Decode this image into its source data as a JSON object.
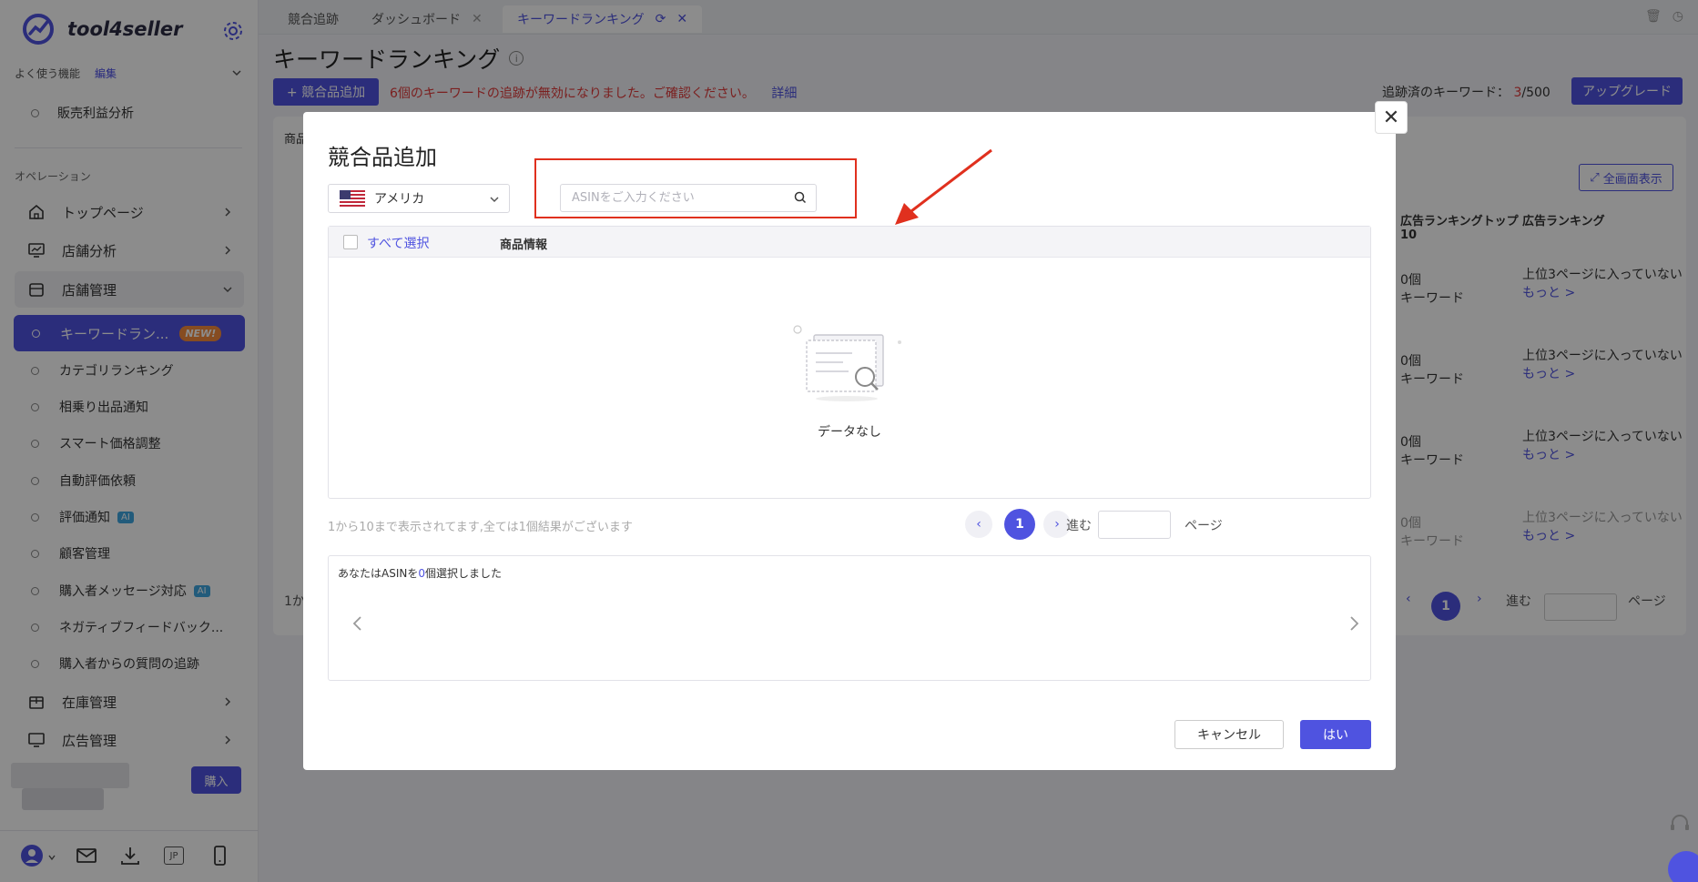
{
  "app": {
    "name": "tool4seller"
  },
  "sidebar": {
    "favorites_label": "よく使う機能",
    "favorites_edit": "編集",
    "favorites_items": [
      "販売利益分析"
    ],
    "section_operations": "オペレーション",
    "nav": [
      {
        "label": "トップページ"
      },
      {
        "label": "店舗分析"
      },
      {
        "label": "店舗管理"
      }
    ],
    "active_item": {
      "label": "キーワードラン...",
      "badge": "NEW!"
    },
    "sub_items": [
      {
        "label": "カテゴリランキング"
      },
      {
        "label": "相乗り出品通知"
      },
      {
        "label": "スマート価格調整"
      },
      {
        "label": "自動評価依頼"
      },
      {
        "label": "評価通知",
        "badge": "AI"
      },
      {
        "label": "顧客管理"
      },
      {
        "label": "購入者メッセージ対応",
        "badge": "AI"
      },
      {
        "label": "ネガティブフィードバック..."
      },
      {
        "label": "購入者からの質問の追跡"
      }
    ],
    "nav_bottom": [
      {
        "label": "在庫管理"
      },
      {
        "label": "広告管理"
      }
    ],
    "buy_button": "購入",
    "bottom_jp": "JP"
  },
  "tabs": [
    {
      "label": "競合追跡"
    },
    {
      "label": "ダッシュボード"
    },
    {
      "label": "キーワードランキング"
    }
  ],
  "page": {
    "title": "キーワードランキング",
    "add_button": "+ 競合品追加",
    "warning": "6個のキーワードの追跡が無効になりました。ご確認ください。",
    "warning_link": "詳細",
    "tracked_label": "追跡済のキーワード：",
    "tracked_used": "3",
    "tracked_total": "/500",
    "upgrade_button": "アップグレード",
    "fullscreen_button": "全画面表示",
    "col_ad_rank_top10": "広告ランキングトップ10",
    "col_ad_rank": "広告ランキング",
    "rows": [
      {
        "count": "0個",
        "kw": "キーワード",
        "rank": "上位3ページに入っていない",
        "more": "もっと >"
      },
      {
        "count": "0個",
        "kw": "キーワード",
        "rank": "上位3ページに入っていない",
        "more": "もっと >"
      },
      {
        "count": "0個",
        "kw": "キーワード",
        "rank": "上位3ページに入っていない",
        "more": "もっと >"
      },
      {
        "count": "0個",
        "kw": "キーワード",
        "rank": "上位3ページに入っていない",
        "more": "もっと >"
      }
    ],
    "bg_page": "1",
    "bg_goto": "進む",
    "bg_page_label": "ページ",
    "bg_head_partial": "商品",
    "bg_footer_partial": "1か"
  },
  "modal": {
    "title": "競合品追加",
    "country": "アメリカ",
    "search_placeholder": "ASINをご入力ください",
    "select_all": "すべて選択",
    "col_product_info": "商品情報",
    "empty_text": "データなし",
    "range_text": "1から10まで表示されてます,全ては1個結果がございます",
    "current_page": "1",
    "goto_label": "進む",
    "page_label": "ページ",
    "selected_prefix": "あなたはASINを",
    "selected_count": "0",
    "selected_suffix": "個選択しました",
    "cancel_button": "キャンセル",
    "ok_button": "はい",
    "close_symbol": "✕"
  },
  "colors": {
    "accent": "#4f53e0",
    "warning": "#e03a3a",
    "highlight_box": "#e0301e"
  }
}
